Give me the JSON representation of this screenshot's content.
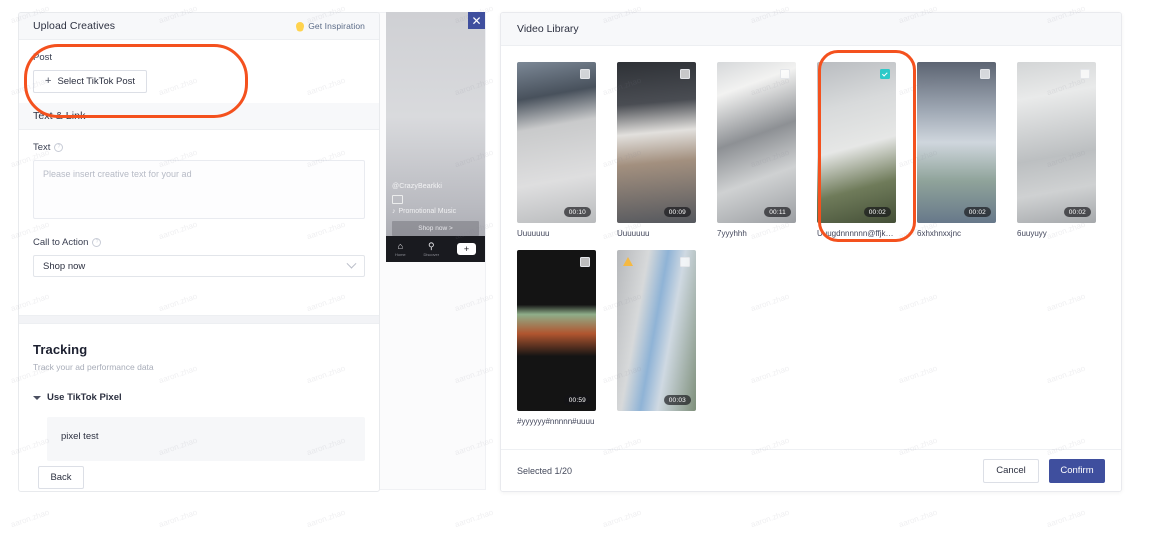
{
  "left_panel": {
    "upload_creatives": {
      "header": "Upload Creatives",
      "inspiration_label": "Get Inspiration",
      "bulb_icon": "lightbulb-icon",
      "post_label": "Post",
      "select_post_button": "Select TikTok Post",
      "plus_icon": "plus-icon"
    },
    "text_and_link": {
      "header": "Text & Link",
      "text_label": "Text",
      "text_value": "",
      "text_placeholder": "Please insert creative text for your ad",
      "cta_label": "Call to Action",
      "cta_value": "Shop now",
      "chevron_icon": "chevron-down-icon",
      "help_icon": "help-circle-icon"
    },
    "tracking": {
      "title": "Tracking",
      "subtitle": "Track your ad performance data",
      "use_pixel_label": "Use TikTok Pixel",
      "caret_icon": "caret-down-icon",
      "pixel_name": "pixel test"
    },
    "back_button": "Back"
  },
  "preview": {
    "close_icon": "close-icon",
    "handle": "@CrazyBearkki",
    "image_icon": "image-icon",
    "music_icon": "music-note-icon",
    "music": "Promotional Music",
    "cta": "Shop now >",
    "navbar": [
      {
        "glyph": "⌂",
        "icon": "home-icon",
        "label": "Home"
      },
      {
        "glyph": "⚲",
        "icon": "search-icon",
        "label": "Discover"
      },
      {
        "glyph": "+",
        "icon": "add-icon",
        "label": ""
      }
    ]
  },
  "video_library": {
    "header": "Video Library",
    "rows": [
      [
        {
          "name": "Uuuuuuu",
          "duration": "00:10",
          "selected": false,
          "warning": false,
          "grad": "linear-gradient(170deg,#7c8896 0%,#48515c 22%,#c9cacb 40%,#dededf 72%,#b9bbbd 100%)"
        },
        {
          "name": "Uuuuuuu",
          "duration": "00:09",
          "selected": false,
          "warning": false,
          "grad": "linear-gradient(175deg,#2e3136 0%,#4a4d53 26%,#e2e0dd 44%,#a3907f 62%,#55585e 100%)"
        },
        {
          "name": "7yyyhhh",
          "duration": "00:11",
          "selected": false,
          "warning": false,
          "grad": "linear-gradient(160deg,#d6d8da 0%,#f2f2f1 18%,#8d9094 46%,#cfd1d2 70%,#9b9ea2 100%)"
        },
        {
          "name": "Uuugdnnnnnn@ffjkdhn...",
          "duration": "00:02",
          "selected": true,
          "warning": false,
          "grad": "linear-gradient(165deg,#b9bcc0 0%,#d8dadb 28%,#e6e7e6 52%,#6f7b5a 76%,#444f37 100%)"
        },
        {
          "name": "6xhxhnxxjnc",
          "duration": "00:02",
          "selected": false,
          "warning": false,
          "grad": "linear-gradient(180deg,#5c6472 0%,#9fa8b4 30%,#cfd6dd 50%,#8fa39a 74%,#67788a 100%)"
        },
        {
          "name": "6uuyuyy",
          "duration": "00:02",
          "selected": false,
          "warning": false,
          "grad": "linear-gradient(170deg,#d3d5d6 0%,#e9eaea 22%,#bcbfc1 58%,#cfd1d2 78%,#a5a8ab 100%)"
        }
      ],
      [
        {
          "name": "#yyyyyy#nnnnn#uuuu",
          "duration": "00:59",
          "selected": false,
          "warning": false,
          "grad": "linear-gradient(180deg,#141414 0%,#141414 34%,#8fae8a 40%,#b0552f 52%,#141414 66%,#141414 100%)"
        },
        {
          "name": "",
          "duration": "00:03",
          "selected": false,
          "warning": true,
          "grad": "linear-gradient(100deg,#b6b8bb 0%,#d7d9da 30%,#8fb3d6 48%,#cfd9e2 64%,#7e8f7a 100%)"
        }
      ]
    ],
    "footer": {
      "selected_text": "Selected 1/20",
      "cancel_label": "Cancel",
      "confirm_label": "Confirm"
    }
  },
  "annotations": {
    "color": "#f4511e",
    "post_block": "highlight-post-block",
    "selected_video": "highlight-selected-video"
  },
  "watermark": {
    "text": "aaron.zhao"
  }
}
